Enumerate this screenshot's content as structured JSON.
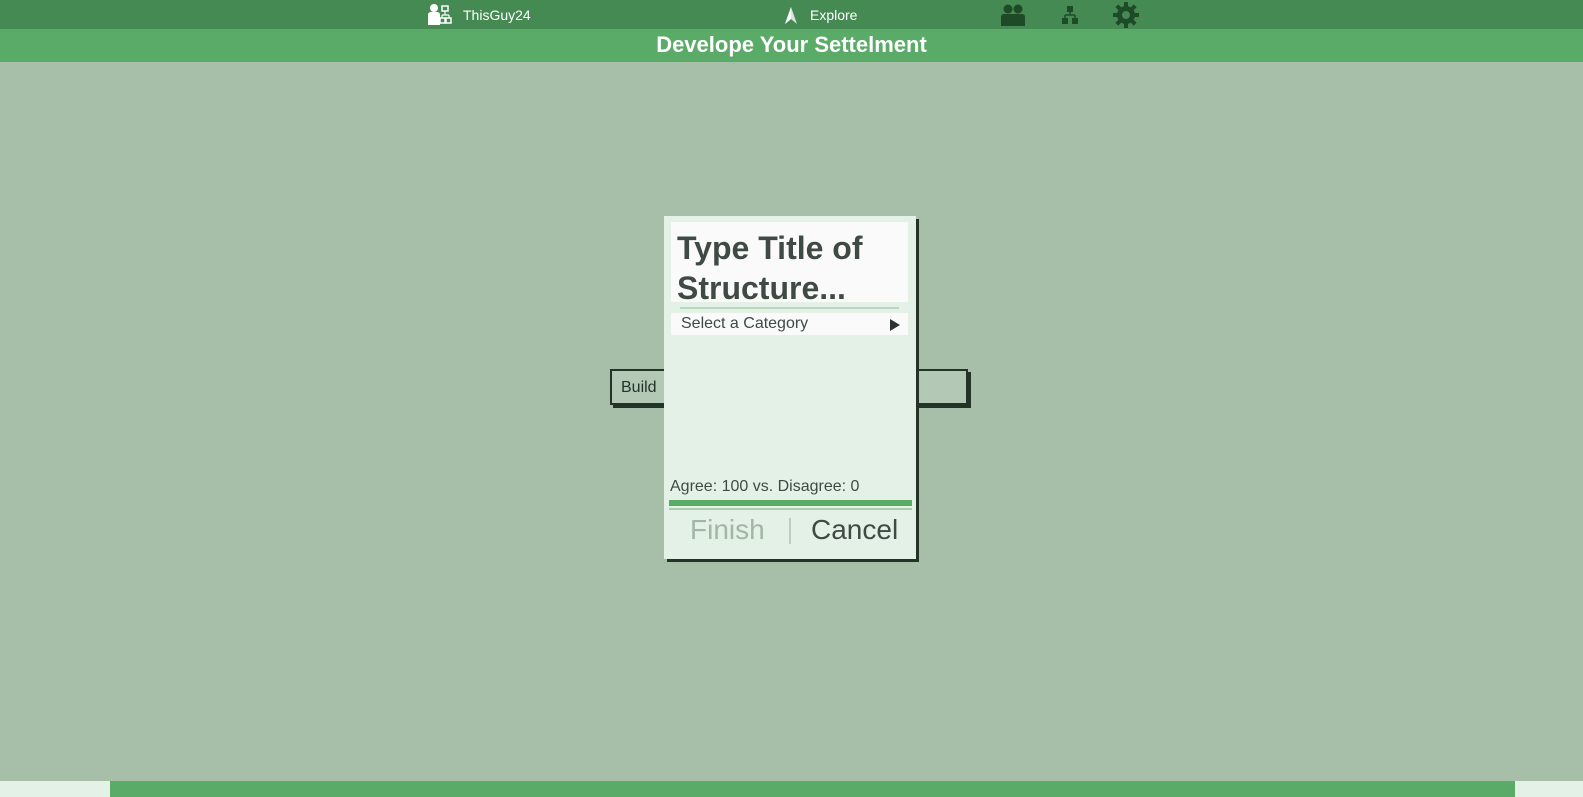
{
  "topbar": {
    "user_label": "ThisGuy24",
    "explore_label": "Explore",
    "icons": [
      "user-network-icon",
      "explore-icon",
      "people-icon",
      "hierarchy-icon",
      "gear-icon"
    ]
  },
  "title_bar": {
    "text": "Develope Your Settelment"
  },
  "build_panel": {
    "label": "Build"
  },
  "dialog": {
    "title_placeholder": "Type Title of Structure...",
    "category_placeholder": "Select a Category",
    "vote_text": "Agree: 100 vs. Disagree: 0",
    "agree_fraction": 1.0,
    "finish_label": "Finish",
    "cancel_label": "Cancel"
  },
  "colors": {
    "topbar": "#458a52",
    "accent": "#5aab68",
    "background": "#a7bea9",
    "dialog": "#e3f1e6",
    "text_dark": "#404a44",
    "disabled": "#a3b6a6"
  }
}
